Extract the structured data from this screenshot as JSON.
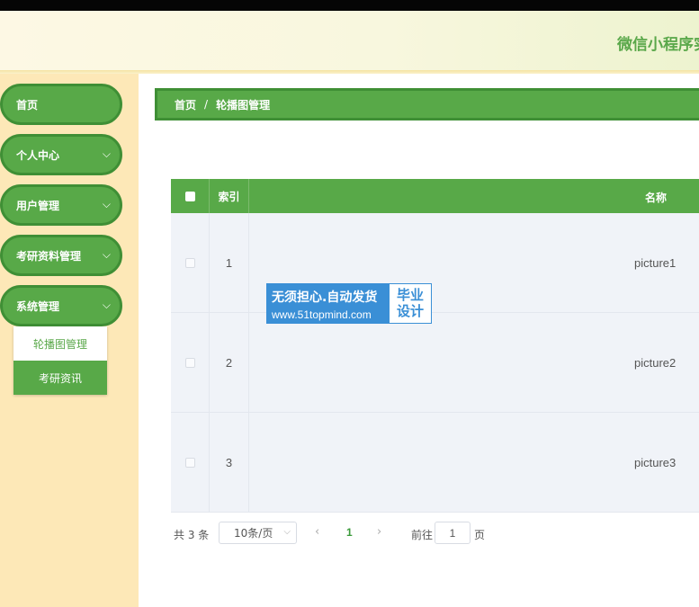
{
  "header": {
    "title": "微信小程序实"
  },
  "sidebar": {
    "items": [
      {
        "label": "首页",
        "chevron": ""
      },
      {
        "label": "个人中心",
        "chevron": "⌵"
      },
      {
        "label": "用户管理",
        "chevron": "⌵"
      },
      {
        "label": "考研资料管理",
        "chevron": "⌵"
      },
      {
        "label": "系统管理",
        "chevron": "⌵"
      }
    ],
    "submenu": [
      {
        "label": "轮播图管理"
      },
      {
        "label": "考研资讯"
      }
    ]
  },
  "breadcrumb": {
    "home": "首页",
    "separator": "/",
    "current": "轮播图管理"
  },
  "table": {
    "columns": {
      "index": "索引",
      "name": "名称"
    },
    "rows": [
      {
        "index": "1",
        "name": "picture1"
      },
      {
        "index": "2",
        "name": "picture2"
      },
      {
        "index": "3",
        "name": "picture3"
      }
    ]
  },
  "watermark": {
    "line1": "无须担心.自动发货",
    "line2": "www.51topmind.com",
    "right_top": "毕业",
    "right_bottom": "设计"
  },
  "pagination": {
    "total": "共 3 条",
    "page_size": "10条/页",
    "current_page": "1",
    "goto_label": "前往",
    "goto_value": "1",
    "page_suffix": "页"
  },
  "colors": {
    "primary": "#58a948",
    "sidebar_bg": "#fde8b7",
    "accent_blue": "#3a8fd6"
  }
}
